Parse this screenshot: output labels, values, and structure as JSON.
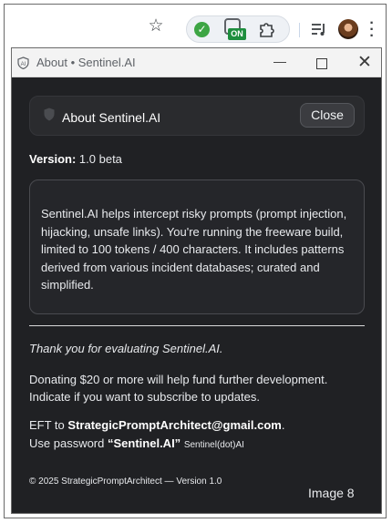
{
  "browser_toolbar": {
    "bookmark_star_icon": "star-icon",
    "extension_badge_label": "ON",
    "extension_badge_color": "#1e8e3e",
    "status_check_color": "#3da544"
  },
  "window": {
    "title": "About • Sentinel.AI"
  },
  "header": {
    "title": "About Sentinel.AI",
    "close_label": "Close"
  },
  "version": {
    "label": "Version:",
    "value": "1.0 beta"
  },
  "description": "Sentinel.AI helps intercept risky prompts (prompt injection, hijacking, unsafe links). You're running the freeware build, limited to 100 tokens / 400 characters. It includes patterns derived from various incident databases; curated and simplified.",
  "thanks": "Thank you for evaluating Sentinel.AI.",
  "donate": "Donating $20 or more will help fund further development. Indicate if you want to subscribe to updates.",
  "eft": {
    "prefix": "EFT to",
    "email": "StrategicPromptArchitect@gmail.com",
    "suffix": "."
  },
  "password": {
    "prefix": "Use password",
    "value": "“Sentinel.AI”",
    "note": "Sentinel(dot)AI"
  },
  "footer": "© 2025 StrategicPromptArchitect — Version 1.0",
  "image_label": "Image 8"
}
